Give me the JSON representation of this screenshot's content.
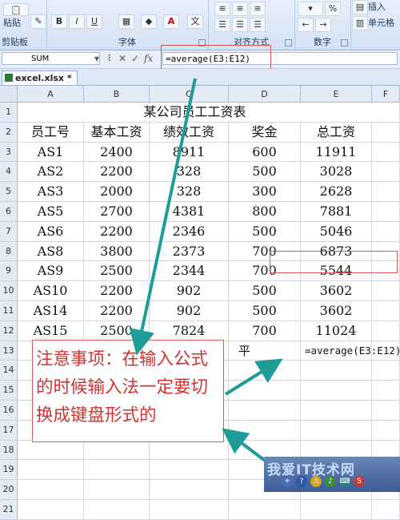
{
  "ribbon": {
    "paste_label": "粘贴",
    "clipboard_label": "剪贴板",
    "font_label": "字体",
    "alignment_label": "对齐方式",
    "number_label": "数字",
    "number_format": "%",
    "cells_insert": "插入",
    "cells_cell": "单元格"
  },
  "formula_bar": {
    "name_box": "SUM",
    "formula": "=average(E3:E12)"
  },
  "tab": {
    "name": "excel.xlsx *"
  },
  "sheet": {
    "columns": [
      "A",
      "B",
      "C",
      "D",
      "E",
      "F"
    ],
    "row_numbers": [
      "1",
      "2",
      "3",
      "4",
      "5",
      "6",
      "7",
      "8",
      "9",
      "10",
      "11",
      "12",
      "13",
      "14",
      "15",
      "16",
      "17",
      "18",
      "19",
      "20",
      "21"
    ],
    "title": "某公司员工工资表",
    "headers": [
      "员工号",
      "基本工资",
      "绩效工资",
      "奖金",
      "总工资"
    ],
    "rows": [
      [
        "AS1",
        "2400",
        "8911",
        "600",
        "11911"
      ],
      [
        "AS2",
        "2200",
        "328",
        "500",
        "3028"
      ],
      [
        "AS3",
        "2000",
        "328",
        "300",
        "2628"
      ],
      [
        "AS5",
        "2700",
        "4381",
        "800",
        "7881"
      ],
      [
        "AS6",
        "2200",
        "2346",
        "500",
        "5046"
      ],
      [
        "AS8",
        "3800",
        "2373",
        "700",
        "6873"
      ],
      [
        "AS9",
        "2500",
        "2344",
        "700",
        "5544"
      ],
      [
        "AS10",
        "2200",
        "902",
        "500",
        "3602"
      ],
      [
        "AS14",
        "2200",
        "902",
        "500",
        "3602"
      ],
      [
        "AS15",
        "2500",
        "7824",
        "700",
        "11024"
      ]
    ],
    "d13": "平",
    "e13": "=average(E3:E12)"
  },
  "annotation": {
    "text": "注意事项：在输入公式的时候输入法一定要切换成键盘形式的"
  },
  "watermark": "我爱IT技术网"
}
